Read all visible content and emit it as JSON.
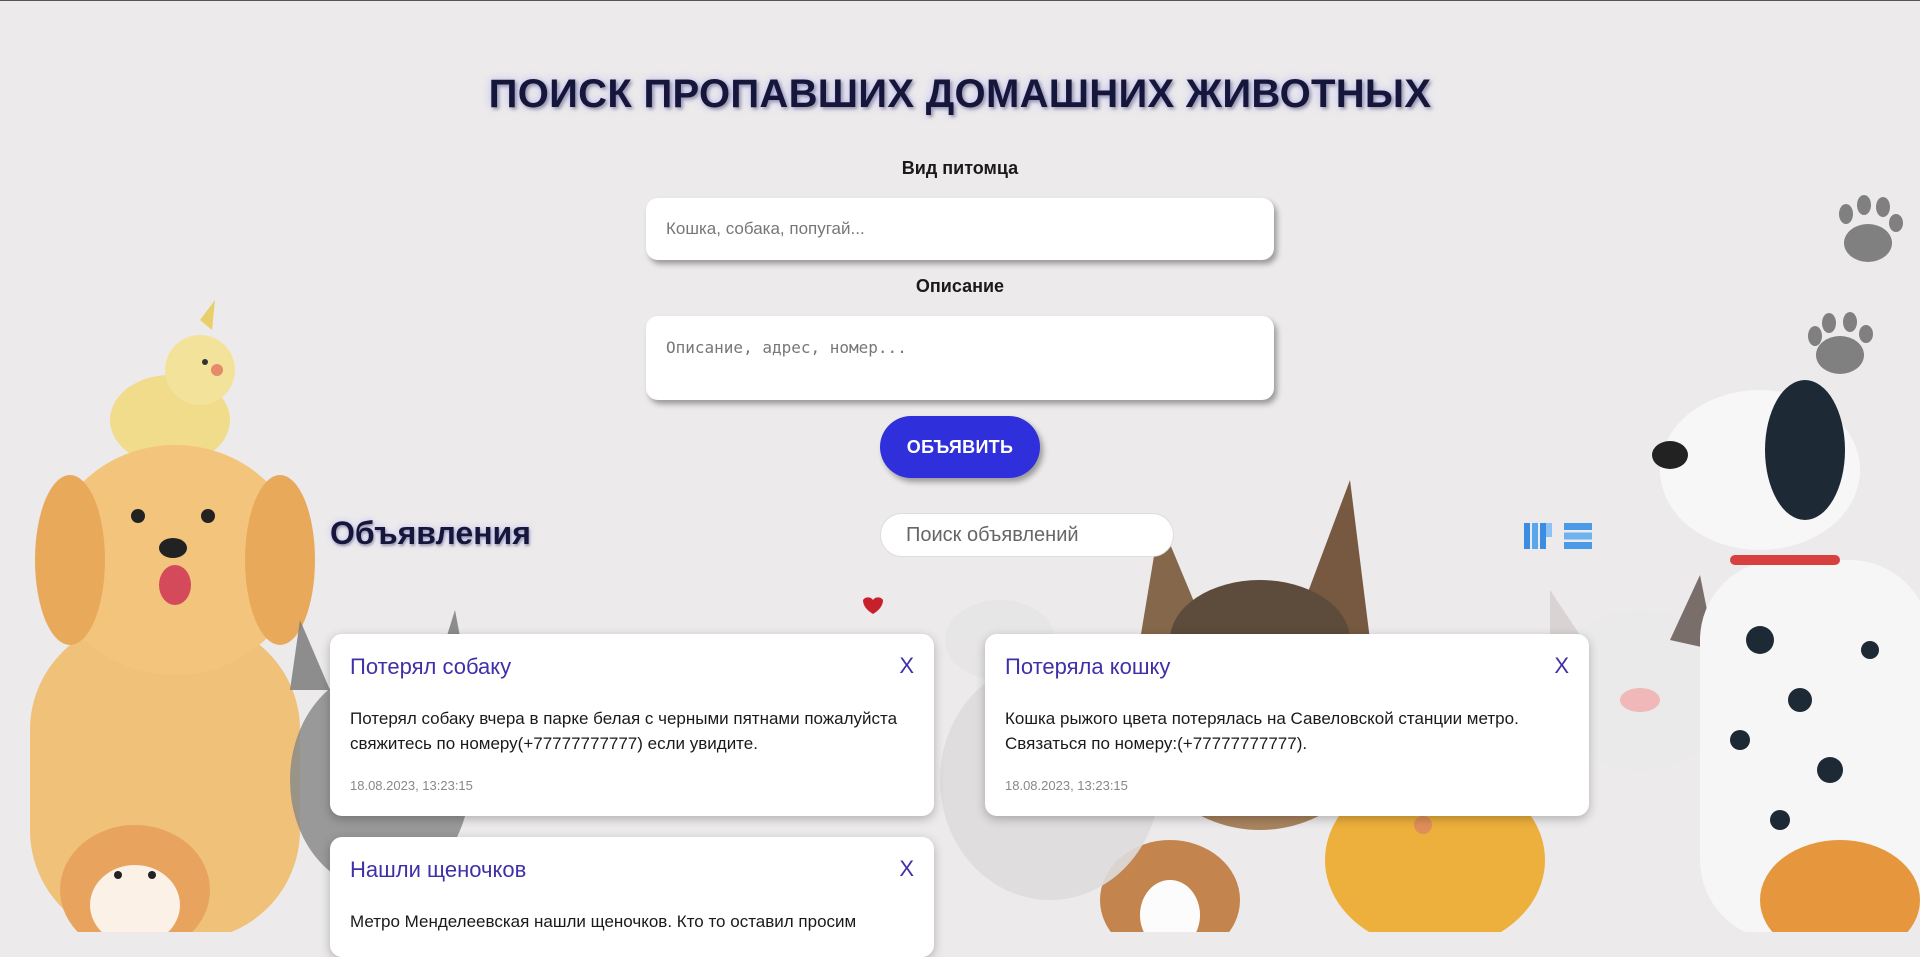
{
  "header": {
    "title": "ПОИСК ПРОПАВШИХ ДОМАШНИХ ЖИВОТНЫХ"
  },
  "form": {
    "species_label": "Вид питомца",
    "species_placeholder": "Кошка, собака, попугай...",
    "description_label": "Описание",
    "description_placeholder": "Описание, адрес, номер...",
    "submit_label": "ОБЪЯВИТЬ"
  },
  "listings": {
    "title": "Объявления",
    "search_placeholder": "Поиск объявлений",
    "view_icons": [
      "grid-view-icon",
      "list-view-icon"
    ],
    "cards": [
      {
        "title": "Потерял собаку",
        "close": "X",
        "text": "Потерял собаку вчера в парке белая с черными пятнами пожалуйста свяжитесь по номеру(+77777777777) если увидите.",
        "date": "18.08.2023, 13:23:15"
      },
      {
        "title": "Потеряла кошку",
        "close": "X",
        "text": "Кошка рыжого цвета потерялась на Савеловской станции метро. Связаться по номеру:(+77777777777).",
        "date": "18.08.2023, 13:23:15"
      },
      {
        "title": "Нашли щеночков",
        "close": "X",
        "text": "Метро Менделеевская нашли щеночков. Кто то оставил просим",
        "date": ""
      }
    ]
  },
  "colors": {
    "accent": "#2f2fdc",
    "card_title": "#4030a8",
    "background": "#eceaeb"
  }
}
